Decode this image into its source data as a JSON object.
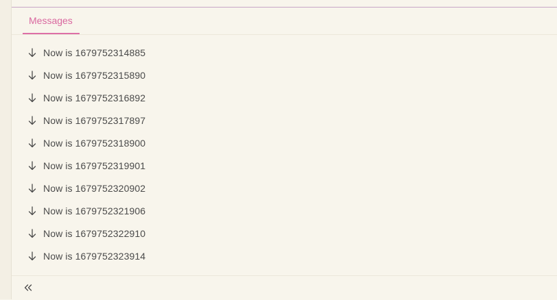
{
  "tabs": [
    {
      "label": "Messages",
      "active": true
    }
  ],
  "messages": [
    {
      "icon": "arrow-down-icon",
      "text": "Now is 1679752314885"
    },
    {
      "icon": "arrow-down-icon",
      "text": "Now is 1679752315890"
    },
    {
      "icon": "arrow-down-icon",
      "text": "Now is 1679752316892"
    },
    {
      "icon": "arrow-down-icon",
      "text": "Now is 1679752317897"
    },
    {
      "icon": "arrow-down-icon",
      "text": "Now is 1679752318900"
    },
    {
      "icon": "arrow-down-icon",
      "text": "Now is 1679752319901"
    },
    {
      "icon": "arrow-down-icon",
      "text": "Now is 1679752320902"
    },
    {
      "icon": "arrow-down-icon",
      "text": "Now is 1679752321906"
    },
    {
      "icon": "arrow-down-icon",
      "text": "Now is 1679752322910"
    },
    {
      "icon": "arrow-down-icon",
      "text": "Now is 1679752323914"
    }
  ],
  "footer": {
    "collapse_icon": "double-chevron-left-icon"
  },
  "colors": {
    "background": "#f8f5ec",
    "accent": "#dd6fa6",
    "text": "#4a4a4a"
  }
}
